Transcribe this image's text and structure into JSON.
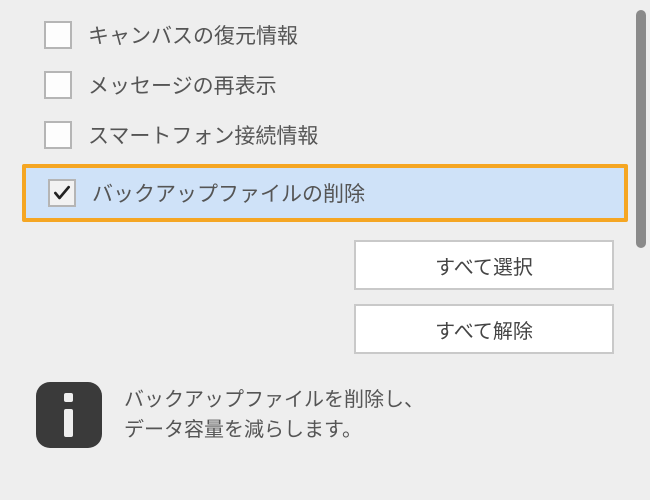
{
  "options": [
    {
      "label": "キャンバスの復元情報",
      "checked": false,
      "highlighted": false
    },
    {
      "label": "メッセージの再表示",
      "checked": false,
      "highlighted": false
    },
    {
      "label": "スマートフォン接続情報",
      "checked": false,
      "highlighted": false
    },
    {
      "label": "バックアップファイルの削除",
      "checked": true,
      "highlighted": true
    }
  ],
  "buttons": {
    "select_all": "すべて選択",
    "deselect_all": "すべて解除"
  },
  "info": {
    "line1": "バックアップファイルを削除し、",
    "line2": "データ容量を減らします。"
  },
  "colors": {
    "highlight_border": "#f5a623",
    "highlight_bg": "#cfe2f8"
  }
}
